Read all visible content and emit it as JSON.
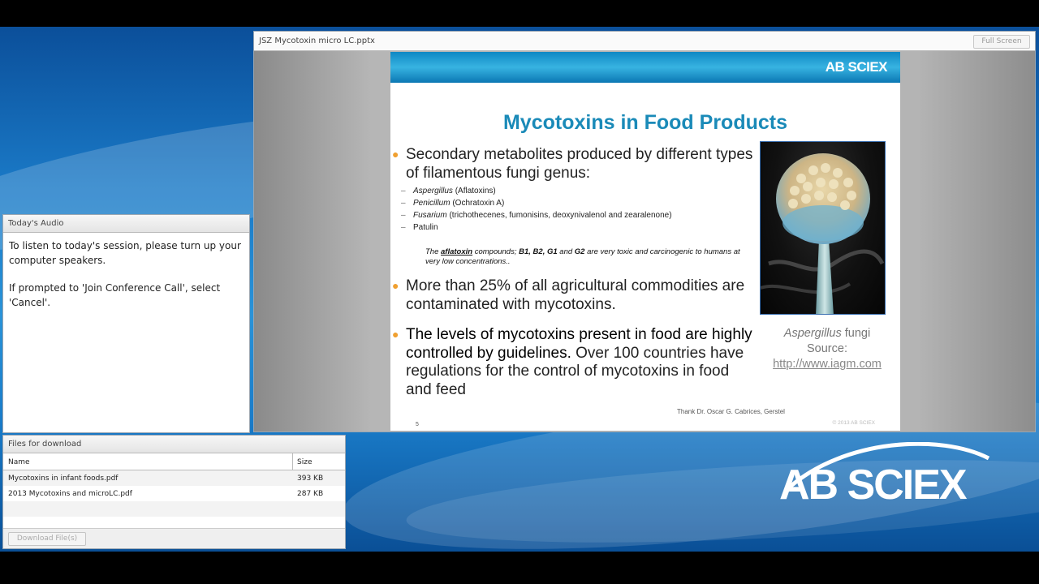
{
  "share_pod": {
    "title": "JSZ Mycotoxin micro LC.pptx",
    "fullscreen_label": "Full Screen"
  },
  "slide": {
    "logo_text": "AB SCIEX",
    "title": "Mycotoxins in Food Products",
    "bullet1": "Secondary metabolites produced by different types of filamentous fungi genus:",
    "subitems": [
      {
        "genus": "Aspergillus",
        "rest": " (Aflatoxins)"
      },
      {
        "genus": "Penicillum",
        "rest": " (Ochratoxin A)"
      },
      {
        "genus": "Fusarium",
        "rest": " (trichothecenes, fumonisins, deoxynivalenol and zearalenone)"
      },
      {
        "genus": "",
        "rest": "Patulin"
      }
    ],
    "note_pre": "The ",
    "note_link": "aflatoxin",
    "note_mid1": " compounds; ",
    "note_b1": "B1, B2, G1",
    "note_mid2": " and ",
    "note_b2": "G2",
    "note_post": " are very toxic and carcinogenic to humans at very low concentrations..",
    "bullet2": "More than 25% of all agricultural commodities are contaminated with mycotoxins.",
    "bullet3_a": " The levels of mycotoxins present in food are highly controlled by guidelines.",
    "bullet3_b": " Over 100 countries have regulations for the control of mycotoxins in food and feed",
    "caption_italic": "Aspergillus",
    "caption_rest": " fungi",
    "caption_source": "Source:",
    "caption_link": "http://www.iagm.com",
    "credit": "Thank Dr. Oscar G. Cabrices, Gerstel",
    "slide_number": "5",
    "copyright": "© 2013 AB SCIEX"
  },
  "audio_pod": {
    "title": "Today's Audio",
    "para1": "To listen to today's session, please turn up your computer speakers.",
    "para2": "If prompted to 'Join Conference Call', select 'Cancel'."
  },
  "files_pod": {
    "title": "Files for download",
    "columns": {
      "name": "Name",
      "size": "Size"
    },
    "rows": [
      {
        "name": "Mycotoxins in infant foods.pdf",
        "size": "393 KB"
      },
      {
        "name": "2013 Mycotoxins and microLC.pdf",
        "size": "287 KB"
      }
    ],
    "download_label": "Download File(s)"
  },
  "brand_logo": "AB SCIEX",
  "colors": {
    "title_blue": "#1a8ab8",
    "bullet_orange": "#f0a030",
    "background_blue": "#1a79c6"
  }
}
